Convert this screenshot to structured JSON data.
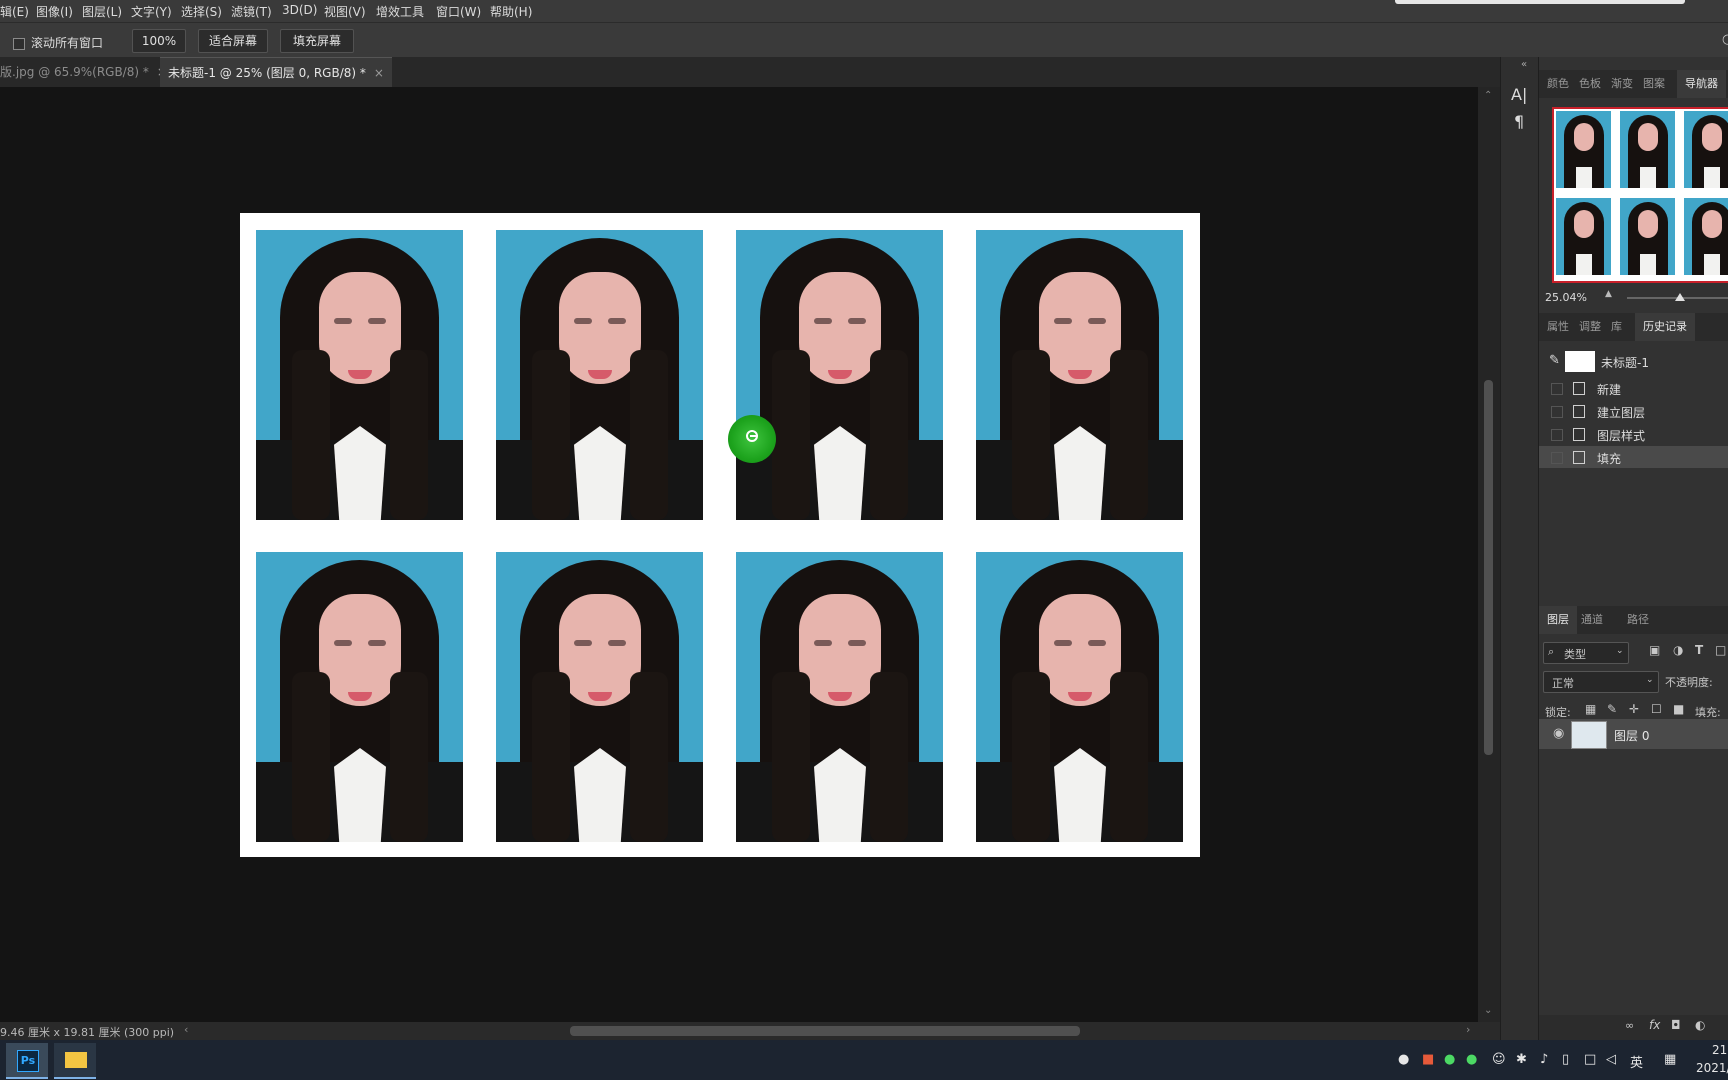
{
  "menu": [
    "辑(E)",
    "图像(I)",
    "图层(L)",
    "文字(Y)",
    "选择(S)",
    "滤镜(T)",
    "3D(D)",
    "视图(V)",
    "增效工具",
    "窗口(W)",
    "帮助(H)"
  ],
  "options": {
    "scroll_all_label": "滚动所有窗口",
    "zoom_value": "100%",
    "fit_screen": "适合屏幕",
    "fill_screen": "填充屏幕"
  },
  "tabs": [
    {
      "label": "版.jpg @ 65.9%(RGB/8) *",
      "active": false
    },
    {
      "label": "未标题-1 @ 25% (图层 0, RGB/8) *",
      "active": true
    }
  ],
  "tab_close": "×",
  "status": {
    "doc_size": "9.46 厘米 x 19.81 厘米 (300 ppi)"
  },
  "tools": {
    "char_glyph": "A|",
    "para_glyph": "¶",
    "collapse": "«"
  },
  "panel_top_tabs": [
    "颜色",
    "色板",
    "渐变",
    "图案",
    "导航器"
  ],
  "navigator": {
    "zoom": "25.04%"
  },
  "panel_mid_tabs": [
    "属性",
    "调整",
    "库",
    "历史记录"
  ],
  "history": {
    "snapshot": "未标题-1",
    "items": [
      "新建",
      "建立图层",
      "图层样式",
      "填充"
    ]
  },
  "layers_tabs": [
    "图层",
    "通道",
    "路径"
  ],
  "layers": {
    "filter_kind": "类型",
    "blend_mode": "正常",
    "opacity_label": "不透明度:",
    "lock_label": "锁定:",
    "fill_label": "填充:",
    "layer_name": "图层 0",
    "fx_label": "fx"
  },
  "taskbar": {
    "ps_label": "Ps",
    "ime": "英",
    "time": "21",
    "date": "2021/"
  },
  "colors": {
    "accent": "#1da31d",
    "photo_bg": "#41a6c9",
    "nav_frame": "#c8202a"
  }
}
